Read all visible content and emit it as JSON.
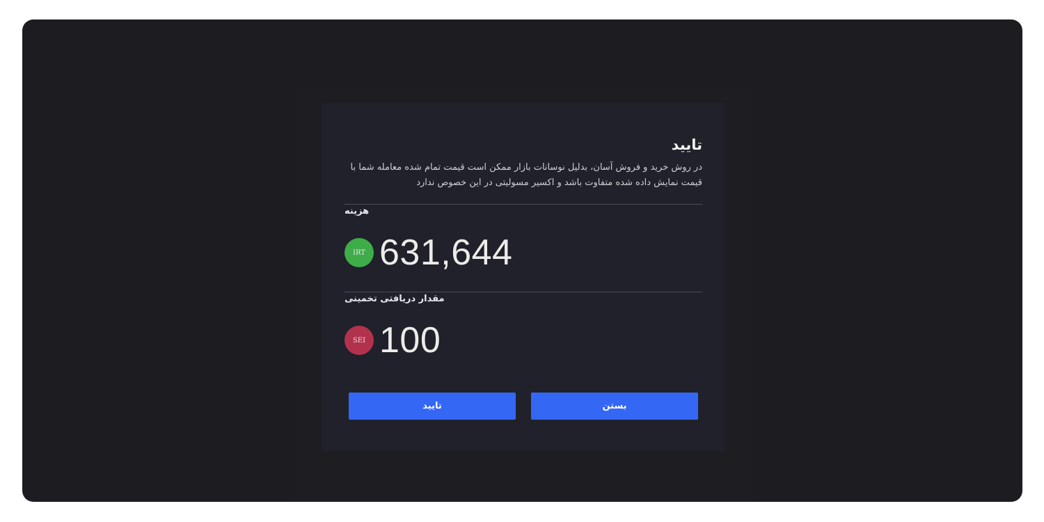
{
  "modal": {
    "title": "تایید",
    "description": "در روش خرید و فروش آسان، بدلیل نوسانات بازار ممکن است قیمت تمام شده معامله شما با قیمت نمایش داده شده متفاوت باشد و اکسیر مسولیتی در این خصوص ندارد",
    "cost": {
      "label": "هزینه",
      "amount": "631,644",
      "currency": "IRT",
      "currency_color": "#3fac4a"
    },
    "receive": {
      "label": "مقدار دریافتی تخمینی",
      "amount": "100",
      "currency": "SEI",
      "currency_color": "#b2324d"
    },
    "buttons": {
      "close_label": "بستن",
      "confirm_label": "تایید",
      "color": "#3567f5"
    }
  }
}
